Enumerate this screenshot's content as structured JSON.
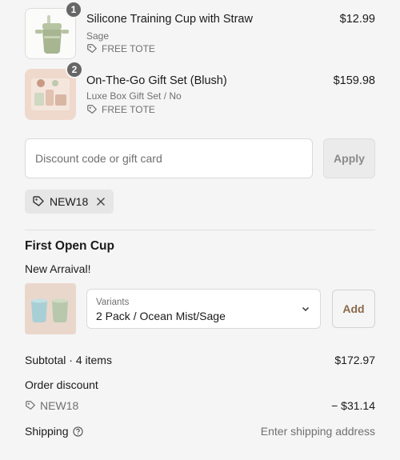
{
  "line_items": [
    {
      "quantity": "1",
      "title": "Silicone Training Cup with Straw",
      "variant": "Sage",
      "tag": "FREE TOTE",
      "price": "$12.99"
    },
    {
      "quantity": "2",
      "title": "On-The-Go Gift Set (Blush)",
      "variant": "Luxe Box Gift Set / No",
      "tag": "FREE TOTE",
      "price": "$159.98"
    }
  ],
  "discount": {
    "placeholder": "Discount code or gift card",
    "apply_label": "Apply",
    "applied_code": "NEW18"
  },
  "upsell": {
    "title": "First Open Cup",
    "subtitle": "New Arraival!",
    "variant_label": "Variants",
    "variant_value": "2 Pack / Ocean Mist/Sage",
    "add_label": "Add"
  },
  "summary": {
    "subtotal_label": "Subtotal · 4 items",
    "subtotal_value": "$172.97",
    "order_discount_label": "Order discount",
    "discount_code": "NEW18",
    "discount_value": "− $31.14",
    "shipping_label": "Shipping",
    "shipping_value": "Enter shipping address"
  },
  "colors": {
    "background": "#f5f5f5",
    "badge": "#666666",
    "add_button_text": "#8a6a4a"
  }
}
